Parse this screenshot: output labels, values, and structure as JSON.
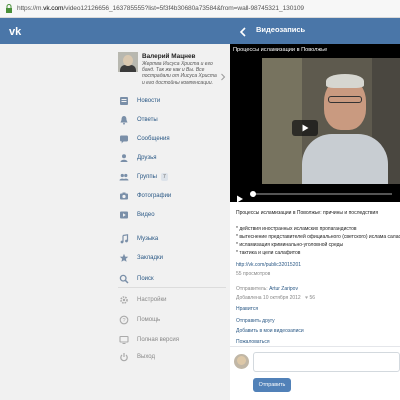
{
  "browser": {
    "url_prefix": "https://m.",
    "url_domain": "vk.com",
    "url_rest": "/video12126656_163785555?list=5f3f4b30680a73584&from=wall-98745321_130109"
  },
  "header": {
    "logo": "vk-logo",
    "title": "Видеозапись"
  },
  "profile": {
    "name": "Валерий Мацнев",
    "status": "Жертва Иисуса Христа и его банд. Так же как и Вы. Все пострадали от Иисуса Христа и его достойны компенсации."
  },
  "menu": [
    {
      "label": "Новости",
      "icon": "news-icon"
    },
    {
      "label": "Ответы",
      "icon": "bell-icon"
    },
    {
      "label": "Сообщения",
      "icon": "message-icon"
    },
    {
      "label": "Друзья",
      "icon": "friends-icon"
    },
    {
      "label": "Группы",
      "icon": "groups-icon",
      "badge": "7"
    },
    {
      "label": "Фотографии",
      "icon": "camera-icon"
    },
    {
      "label": "Видео",
      "icon": "video-icon"
    },
    {
      "label": "Музыка",
      "icon": "music-icon"
    },
    {
      "label": "Закладки",
      "icon": "star-icon"
    },
    {
      "label": "Поиск",
      "icon": "search-icon"
    },
    {
      "label": "Настройки",
      "icon": "gear-icon"
    },
    {
      "label": "Помощь",
      "icon": "help-icon"
    },
    {
      "label": "Полная версия",
      "icon": "monitor-icon"
    },
    {
      "label": "Выход",
      "icon": "power-icon"
    }
  ],
  "video": {
    "title": "Процессы исламизации в Поволжье",
    "description_title": "Процессы исламизации в Поволжье: причины и последствия",
    "points": [
      "* действия иностранных исламских пропагандистов",
      "* вытеснение представителей официального (светского) ислама салафи",
      "* исламизация криминально-уголовной среды",
      "* тактика и цели салафитов"
    ],
    "link": "http://vk.com/public32015201",
    "views": "55 просмотров",
    "sender_label": "Отправитель:",
    "sender": "Artur Zaripov",
    "added": "Добавлена 10 октября 2012",
    "likes": "56",
    "like_label": "Нравится",
    "share_label": "Отправить другу",
    "add_label": "Добавить в мои видеозаписи",
    "report_label": "Пожаловаться",
    "send_button": "Отправить"
  }
}
